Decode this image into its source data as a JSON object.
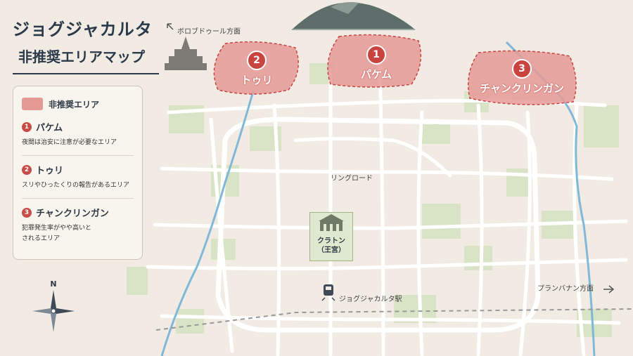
{
  "title": {
    "line1": "ジョグジャカルタ",
    "line2": "非推奨エリアマップ"
  },
  "legend": {
    "key_label": "非推奨エリア",
    "items": [
      {
        "num": "1",
        "name": "パケム",
        "desc": "夜間は治安に注意が必要なエリア"
      },
      {
        "num": "2",
        "name": "トゥリ",
        "desc": "スリやひったくりの報告があるエリア"
      },
      {
        "num": "3",
        "name": "チャンクリンガン",
        "desc_line1": "犯罪発生率がやや高いと",
        "desc_line2": "されるエリア"
      }
    ]
  },
  "zones": [
    {
      "num": "1",
      "name": "パケム"
    },
    {
      "num": "2",
      "name": "トゥリ"
    },
    {
      "num": "3",
      "name": "チャンクリンガン"
    }
  ],
  "labels": {
    "borobudur": "ボロブドゥール方面",
    "ring_road": "リングロード",
    "prambanan": "プランバナン方面",
    "station": "ジョグジャカルタ駅",
    "kraton_line1": "クラトン",
    "kraton_line2": "（王宮）",
    "compass_n": "N"
  },
  "colors": {
    "background": "#f1ebe3",
    "zone_fill": "#e69a96",
    "zone_badge": "#c9433f",
    "river": "#7fb8d8",
    "green": "#d9e3c6"
  },
  "icons": [
    "mountain-icon",
    "temple-icon",
    "kraton-palace-icon",
    "train-icon",
    "compass-icon",
    "arrow-icon"
  ]
}
